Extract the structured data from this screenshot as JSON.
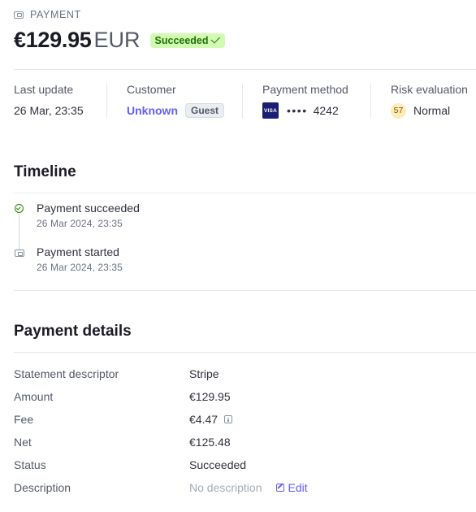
{
  "header": {
    "label": "PAYMENT",
    "amount": "€129.95",
    "currency": "EUR",
    "status": "Succeeded"
  },
  "summary": {
    "last_update": {
      "label": "Last update",
      "value": "26 Mar, 23:35"
    },
    "customer": {
      "label": "Customer",
      "value": "Unknown",
      "badge": "Guest"
    },
    "payment_method": {
      "label": "Payment method",
      "brand": "VISA",
      "dots": "••••",
      "last4": "4242"
    },
    "risk": {
      "label": "Risk evaluation",
      "score": "57",
      "value": "Normal"
    }
  },
  "timeline": {
    "title": "Timeline",
    "events": [
      {
        "title": "Payment succeeded",
        "time": "26 Mar 2024, 23:35",
        "icon": "check-circle-icon"
      },
      {
        "title": "Payment started",
        "time": "26 Mar 2024, 23:35",
        "icon": "payment-icon"
      }
    ]
  },
  "details": {
    "title": "Payment details",
    "rows": [
      {
        "label": "Statement descriptor",
        "value": "Stripe"
      },
      {
        "label": "Amount",
        "value": "€129.95"
      },
      {
        "label": "Fee",
        "value": "€4.47"
      },
      {
        "label": "Net",
        "value": "€125.48"
      },
      {
        "label": "Status",
        "value": "Succeeded"
      },
      {
        "label": "Description",
        "value": "No description",
        "action": "Edit"
      }
    ]
  },
  "colors": {
    "accent": "#635bff",
    "success_bg": "#d1fab3",
    "success_text": "#217005",
    "risk_bg": "#fcedb9",
    "visa_blue": "#1a1f71"
  }
}
